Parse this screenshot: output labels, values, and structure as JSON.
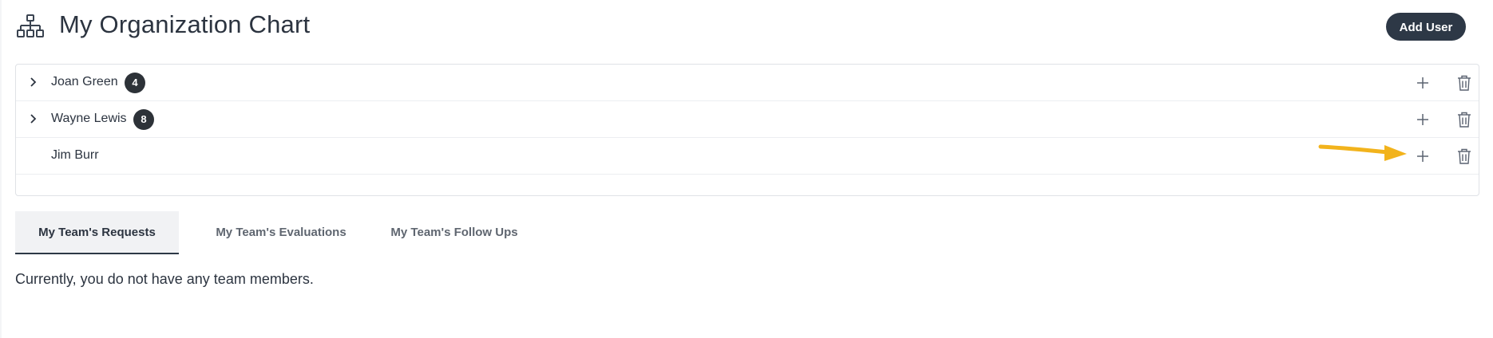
{
  "header": {
    "title": "My Organization Chart",
    "icon": "org-chart-icon",
    "add_user_label": "Add User"
  },
  "tree": {
    "rows": [
      {
        "name": "Joan Green",
        "count": "4",
        "expandable": true
      },
      {
        "name": "Wayne Lewis",
        "count": "8",
        "expandable": true
      },
      {
        "name": "Jim Burr",
        "count": "",
        "expandable": false
      }
    ],
    "row_actions": [
      "plus-icon",
      "trash-icon"
    ]
  },
  "annotation": {
    "arrow_color": "#f2b31c"
  },
  "tabs": [
    {
      "label": "My Team's Requests",
      "active": true
    },
    {
      "label": "My Team's Evaluations",
      "active": false
    },
    {
      "label": "My Team's Follow Ups",
      "active": false
    }
  ],
  "content": {
    "empty_message": "Currently, you do not have any team members."
  },
  "colors": {
    "primary": "#2d3846",
    "text": "#2c3440",
    "badge": "#2d3238",
    "border": "#dfe2e6"
  }
}
